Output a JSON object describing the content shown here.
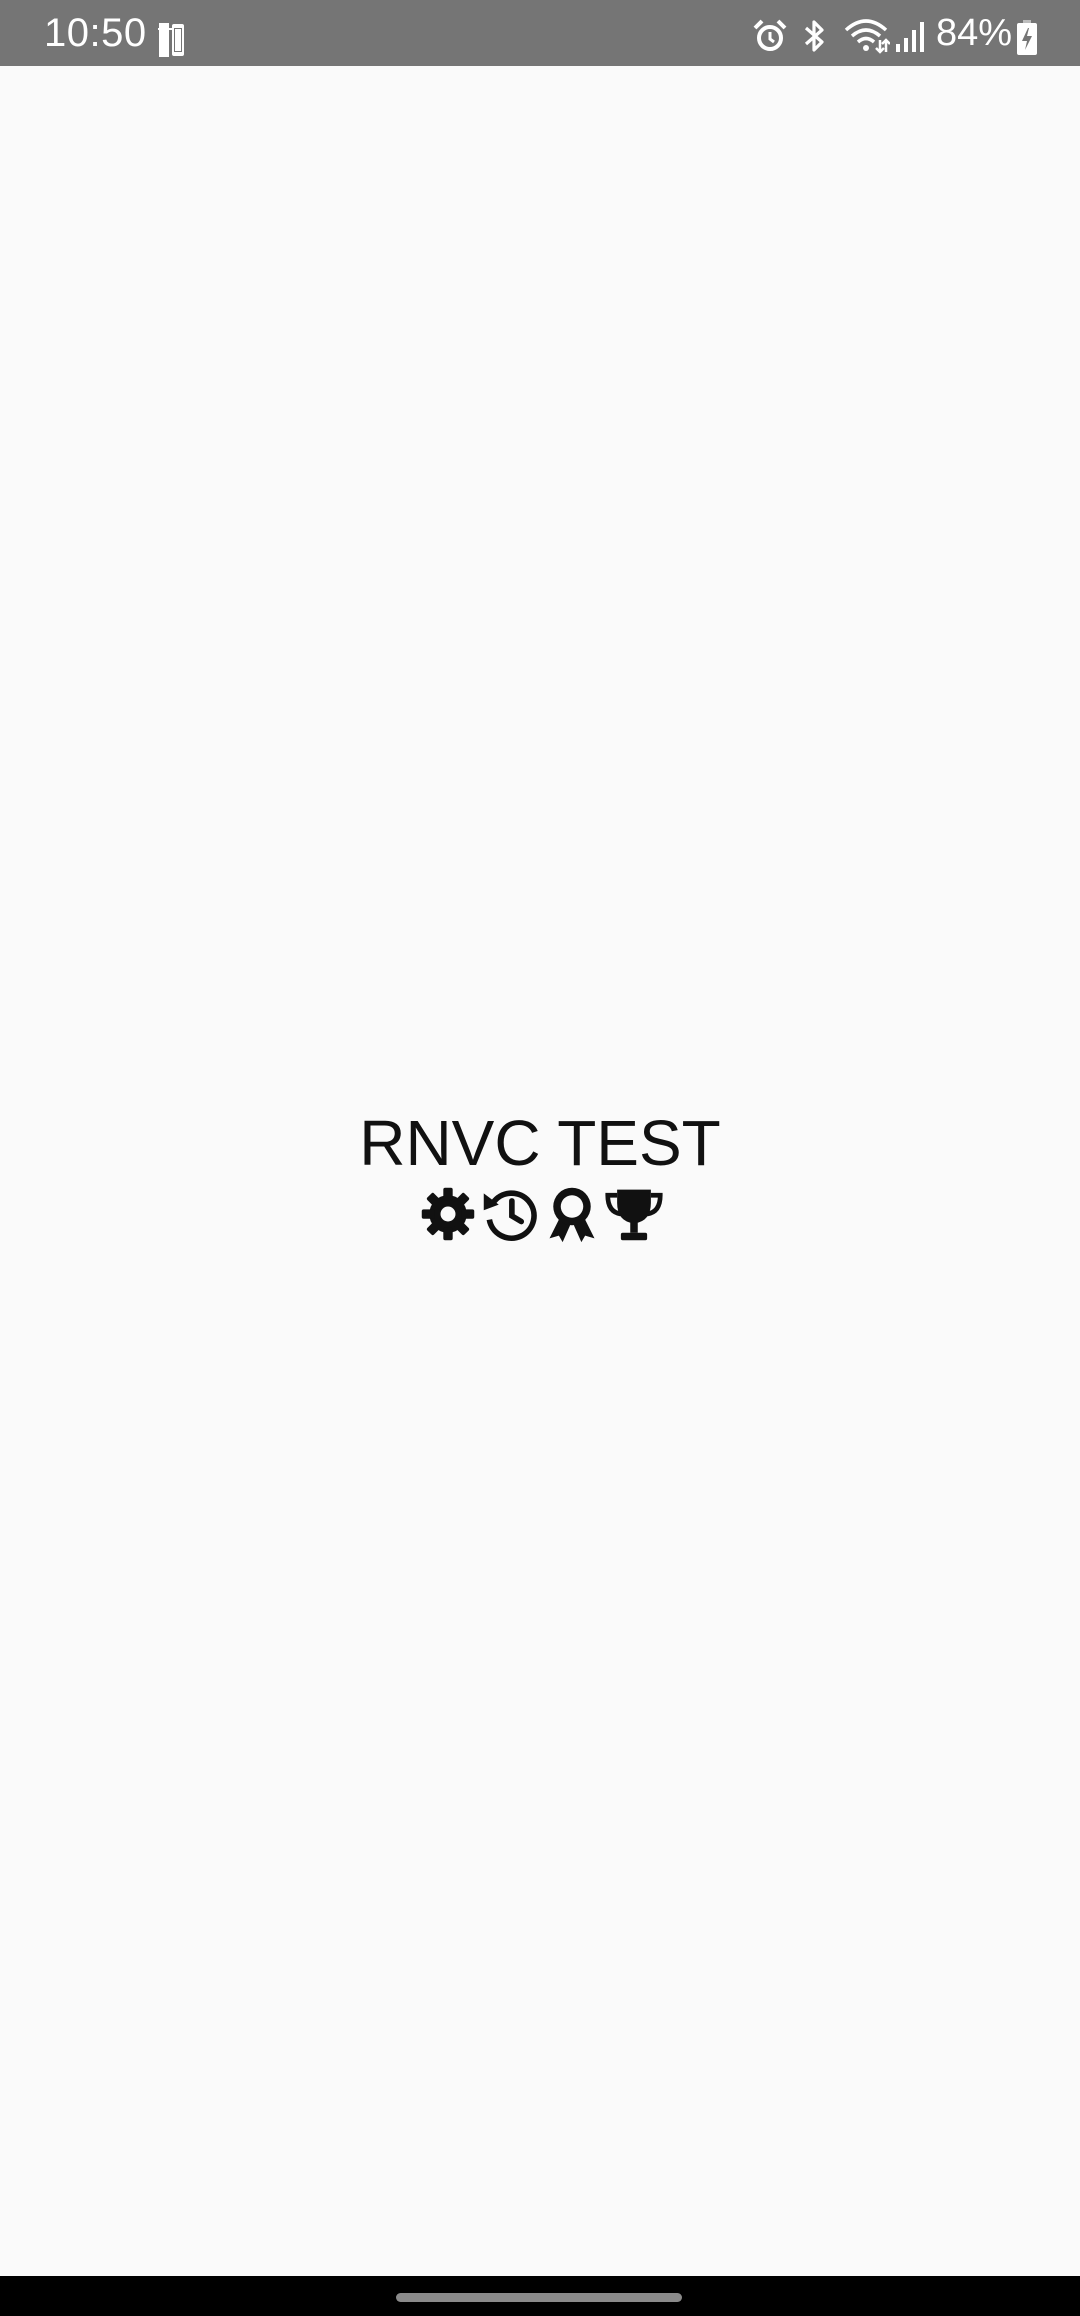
{
  "status_bar": {
    "time": "10:50",
    "left_icon": "phone-rotate-icon",
    "right_icons": [
      "alarm-icon",
      "bluetooth-icon",
      "wifi-icon",
      "signal-icon",
      "battery-charging-icon"
    ],
    "battery_percent": "84%"
  },
  "main": {
    "title": "RNVC TEST",
    "icons": [
      "gear-icon",
      "history-icon",
      "award-icon",
      "trophy-icon"
    ]
  },
  "nav_bar": {
    "home_indicator": "home-pill"
  },
  "colors": {
    "status_bar_bg": "#757575",
    "background": "#fafafa",
    "text": "#111111",
    "nav_bar_bg": "#000000"
  }
}
